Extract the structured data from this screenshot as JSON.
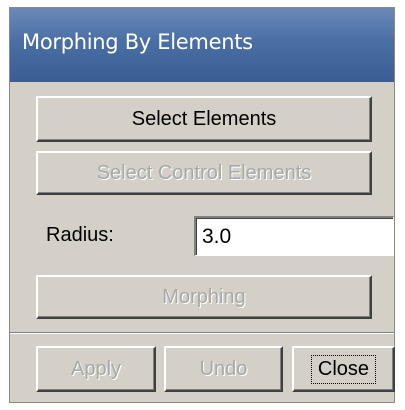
{
  "dialog": {
    "title": "Morphing By Elements"
  },
  "buttons": {
    "select_elements": "Select Elements",
    "select_control_elements": "Select Control Elements",
    "morphing": "Morphing",
    "apply": "Apply",
    "undo": "Undo",
    "close": "Close"
  },
  "radius": {
    "label": "Radius:",
    "value": "3.0"
  }
}
